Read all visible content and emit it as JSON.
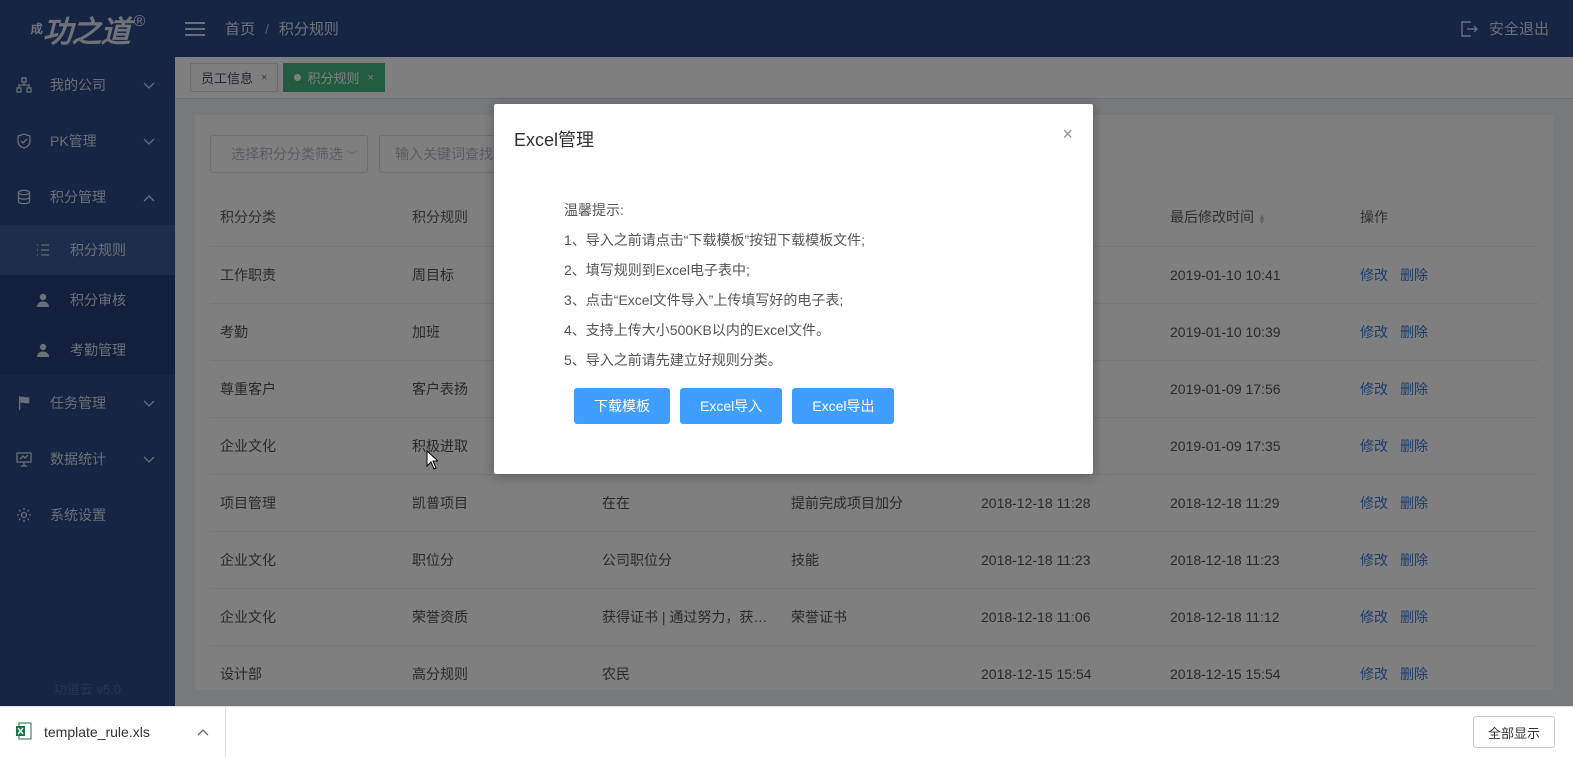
{
  "brand": {
    "logo_small": "成",
    "logo_text": "功之道",
    "registered": "®",
    "version": "功道云 v5.0"
  },
  "header": {
    "crumb_home": "首页",
    "crumb_sep": "/",
    "crumb_current": "积分规则",
    "logout": "安全退出"
  },
  "sidebar": {
    "items": [
      {
        "label": "我的公司",
        "icon": "org-icon",
        "expanded": false
      },
      {
        "label": "PK管理",
        "icon": "shield-icon",
        "expanded": false
      },
      {
        "label": "积分管理",
        "icon": "database-icon",
        "expanded": true
      },
      {
        "label": "任务管理",
        "icon": "flag-icon",
        "expanded": false
      },
      {
        "label": "数据统计",
        "icon": "monitor-icon",
        "expanded": false
      },
      {
        "label": "系统设置",
        "icon": "gear-icon"
      }
    ],
    "subitems": [
      {
        "label": "积分规则",
        "icon": "list-icon",
        "active": true
      },
      {
        "label": "积分审核",
        "icon": "user-icon"
      },
      {
        "label": "考勤管理",
        "icon": "user-icon"
      }
    ]
  },
  "tabs": [
    {
      "label": "员工信息",
      "close": "×",
      "active": false
    },
    {
      "label": "积分规则",
      "close": "×",
      "active": true
    }
  ],
  "filters": {
    "category_placeholder": "选择积分分类筛选",
    "search_placeholder": "输入关键词查找"
  },
  "table": {
    "headers": [
      "积分分类",
      "积分规则",
      "",
      "",
      "",
      "最后修改时间",
      "操作"
    ],
    "actions": {
      "edit": "修改",
      "delete": "删除"
    },
    "rows": [
      [
        "工作职责",
        "周目标",
        "",
        "",
        "",
        "2019-01-10 10:41"
      ],
      [
        "考勤",
        "加班",
        "",
        "",
        "",
        "2019-01-10 10:39"
      ],
      [
        "尊重客户",
        "客户表扬",
        "",
        "",
        "",
        "2019-01-09 17:56"
      ],
      [
        "企业文化",
        "积极进取",
        "",
        "",
        "",
        "2019-01-09 17:35"
      ],
      [
        "项目管理",
        "凯普项目",
        "在在",
        "提前完成项目加分",
        "2018-12-18 11:28",
        "2018-12-18 11:29"
      ],
      [
        "企业文化",
        "职位分",
        "公司职位分",
        "技能",
        "2018-12-18 11:23",
        "2018-12-18 11:23"
      ],
      [
        "企业文化",
        "荣誉资质",
        "获得证书 | 通过努力，获得相关证书",
        "荣誉证书",
        "2018-12-18 11:06",
        "2018-12-18 11:12"
      ],
      [
        "设计部",
        "高分规则",
        "农民",
        "",
        "2018-12-15 15:54",
        "2018-12-15 15:54"
      ]
    ]
  },
  "modal": {
    "title": "Excel管理",
    "close": "×",
    "tips": [
      "温馨提示:",
      "1、导入之前请点击“下载模板”按钮下载模板文件;",
      "2、填写规则到Excel电子表中;",
      "3、点击“Excel文件导入”上传填写好的电子表;",
      "4、支持上传大小500KB以内的Excel文件。",
      "5、导入之前请先建立好规则分类。"
    ],
    "buttons": {
      "download": "下载模板",
      "import": "Excel导入",
      "export": "Excel导出"
    },
    "accent": "#409eff"
  },
  "download_bar": {
    "filename": "template_rule.xls",
    "show_all": "全部显示"
  }
}
